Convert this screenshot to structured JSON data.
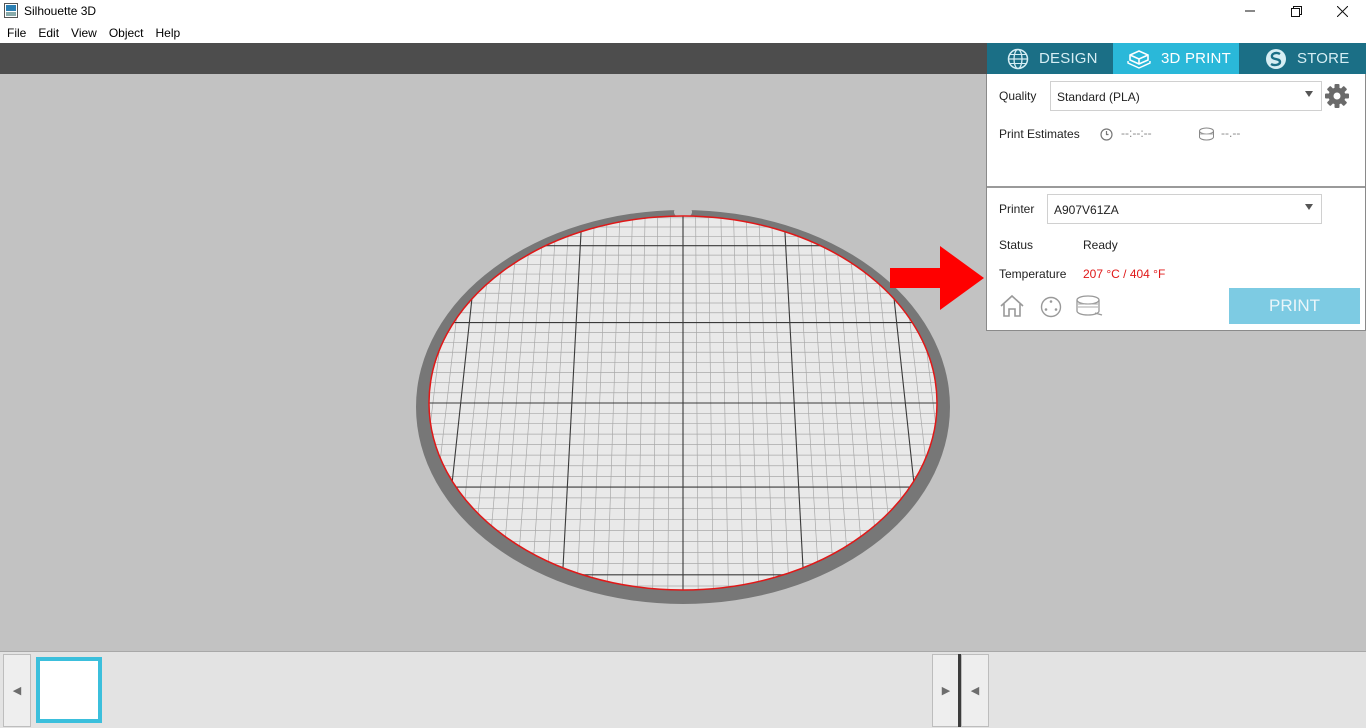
{
  "window": {
    "title": "Silhouette 3D",
    "icons": {
      "app": "silhouette-3d-app-icon",
      "minimize": "minimize-icon",
      "maximize": "restore-icon",
      "close": "close-icon"
    }
  },
  "menu": {
    "items": [
      "File",
      "Edit",
      "View",
      "Object",
      "Help"
    ]
  },
  "mode_tabs": {
    "design": "DESIGN",
    "print3d": "3D PRINT",
    "store": "STORE",
    "active": "3D PRINT",
    "colors": {
      "active": "#2ab8d9",
      "inactive": "#1b6f86"
    }
  },
  "print_panel": {
    "quality_label": "Quality",
    "quality_value": "Standard (PLA)",
    "estimates_label": "Print Estimates",
    "time_estimate": "--:--:--",
    "material_estimate": "--.--",
    "printer_label": "Printer",
    "printer_value": "A907V61ZA",
    "status_label": "Status",
    "status_value": "Ready",
    "temperature_label": "Temperature",
    "temperature_value": "207 °C / 404 °F",
    "temperature_color": "#e01818",
    "print_button": "PRINT",
    "print_button_color": "#7dcbe3"
  },
  "annotation": {
    "arrow_color": "#ff0000",
    "icon": "red-arrow-icon"
  },
  "thumbnails": {
    "count": 1,
    "selected_border_color": "#3bbfdc"
  }
}
